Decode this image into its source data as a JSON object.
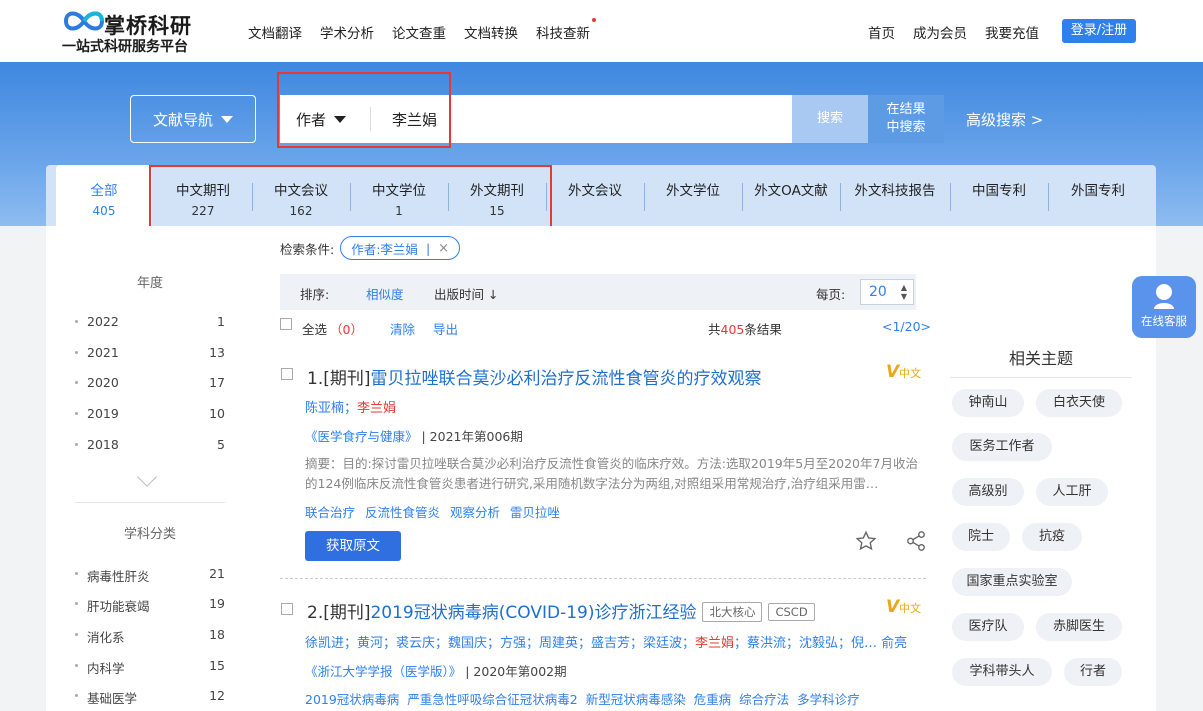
{
  "brand": {
    "name": "掌桥科研",
    "tagline": "一站式科研服务平台"
  },
  "topnav": {
    "items": [
      "文档翻译",
      "学术分析",
      "论文查重",
      "文档转换",
      "科技查新"
    ]
  },
  "usernav": {
    "items": [
      "首页",
      "成为会员",
      "我要充值"
    ],
    "login": "登录/注册"
  },
  "search": {
    "nav_dropdown": "文献导航",
    "field": "作者",
    "query": "李兰娟",
    "search_button": "搜索",
    "search_within": [
      "在结果",
      "中搜索"
    ],
    "advanced": "高级搜索 >"
  },
  "tabs": [
    {
      "label": "全部",
      "count": "405"
    },
    {
      "label": "中文期刊",
      "count": "227"
    },
    {
      "label": "中文会议",
      "count": "162"
    },
    {
      "label": "中文学位",
      "count": "1"
    },
    {
      "label": "外文期刊",
      "count": "15"
    },
    {
      "label": "外文会议",
      "count": ""
    },
    {
      "label": "外文学位",
      "count": ""
    },
    {
      "label": "外文OA文献",
      "count": ""
    },
    {
      "label": "外文科技报告",
      "count": ""
    },
    {
      "label": "中国专利",
      "count": ""
    },
    {
      "label": "外国专利",
      "count": ""
    }
  ],
  "conditions": {
    "label": "检索条件:",
    "chip": "作者:李兰娟",
    "chip_sep": "|",
    "chip_close": "×"
  },
  "sort": {
    "label": "排序:",
    "relevance": "相似度",
    "date": "出版时间",
    "date_arrow": "↓",
    "per_page_label": "每页:",
    "per_page": "20",
    "per_page_arrows": "▲▼"
  },
  "results_bar": {
    "select_all": "全选",
    "selected": "（0）",
    "clear": "清除",
    "export": "导出",
    "total_prefix": "共",
    "total": "405",
    "total_suffix": "条结果",
    "pager": "<1/20>"
  },
  "facets": {
    "year_title": "年度",
    "years": [
      {
        "label": "2022",
        "count": "1"
      },
      {
        "label": "2021",
        "count": "13"
      },
      {
        "label": "2020",
        "count": "17"
      },
      {
        "label": "2019",
        "count": "10"
      },
      {
        "label": "2018",
        "count": "5"
      }
    ],
    "subject_title": "学科分类",
    "subjects": [
      {
        "label": "病毒性肝炎",
        "count": "21"
      },
      {
        "label": "肝功能衰竭",
        "count": "19"
      },
      {
        "label": "消化系",
        "count": "18"
      },
      {
        "label": "内科学",
        "count": "15"
      },
      {
        "label": "基础医学",
        "count": "12"
      }
    ]
  },
  "results": [
    {
      "num": "1.[期刊]",
      "title": "雷贝拉唑联合莫沙必利治疗反流性食管炎的疗效观察",
      "authors_pre": "陈亚楠；",
      "author_me": "李兰娟",
      "authors_post": "",
      "source": "《医学食疗与健康》",
      "issue": "| 2021年第006期",
      "abstract": "摘要：目的:探讨雷贝拉唑联合莫沙必利治疗反流性食管炎的临床疗效。方法:选取2019年5月至2020年7月收治的124例临床反流性食管炎患者进行研究,采用随机数字法分为两组,对照组采用常规治疗,治疗组采用雷…",
      "keywords": "联合治疗 反流性食管炎 观察分析 雷贝拉唑",
      "fetch": "获取原文",
      "badge_v": "V",
      "badge_text": "中文"
    },
    {
      "num": "2.[期刊]",
      "title": "2019冠状病毒病(COVID-19)诊疗浙江经验",
      "tags": [
        "北大核心",
        "CSCD"
      ],
      "authors_pre": "徐凯进；黄河；裘云庆；魏国庆；方强；周建英；盛吉芳；梁廷波；",
      "author_me": "李兰娟",
      "authors_post": "；蔡洪流；沈毅弘；倪… 俞亮",
      "source": "《浙江大学学报（医学版）》",
      "issue": "| 2020年第002期",
      "keywords": "2019冠状病毒病 严重急性呼吸综合征冠状病毒2 新型冠状病毒感染 危重病 综合疗法 多学科诊疗",
      "badge_v": "V",
      "badge_text": "中文"
    }
  ],
  "related": {
    "title": "相关主题",
    "tags": [
      "钟南山",
      "白衣天使",
      "医务工作者",
      "高级别",
      "人工肝",
      "院士",
      "抗疫",
      "国家重点实验室",
      "医疗队",
      "赤脚医生",
      "学科带头人",
      "行者"
    ]
  },
  "service": {
    "label": "在线客服"
  },
  "colors": {
    "accent": "#2f80ed",
    "highlight_box": "#e53935",
    "band": "#4a8fe4"
  }
}
